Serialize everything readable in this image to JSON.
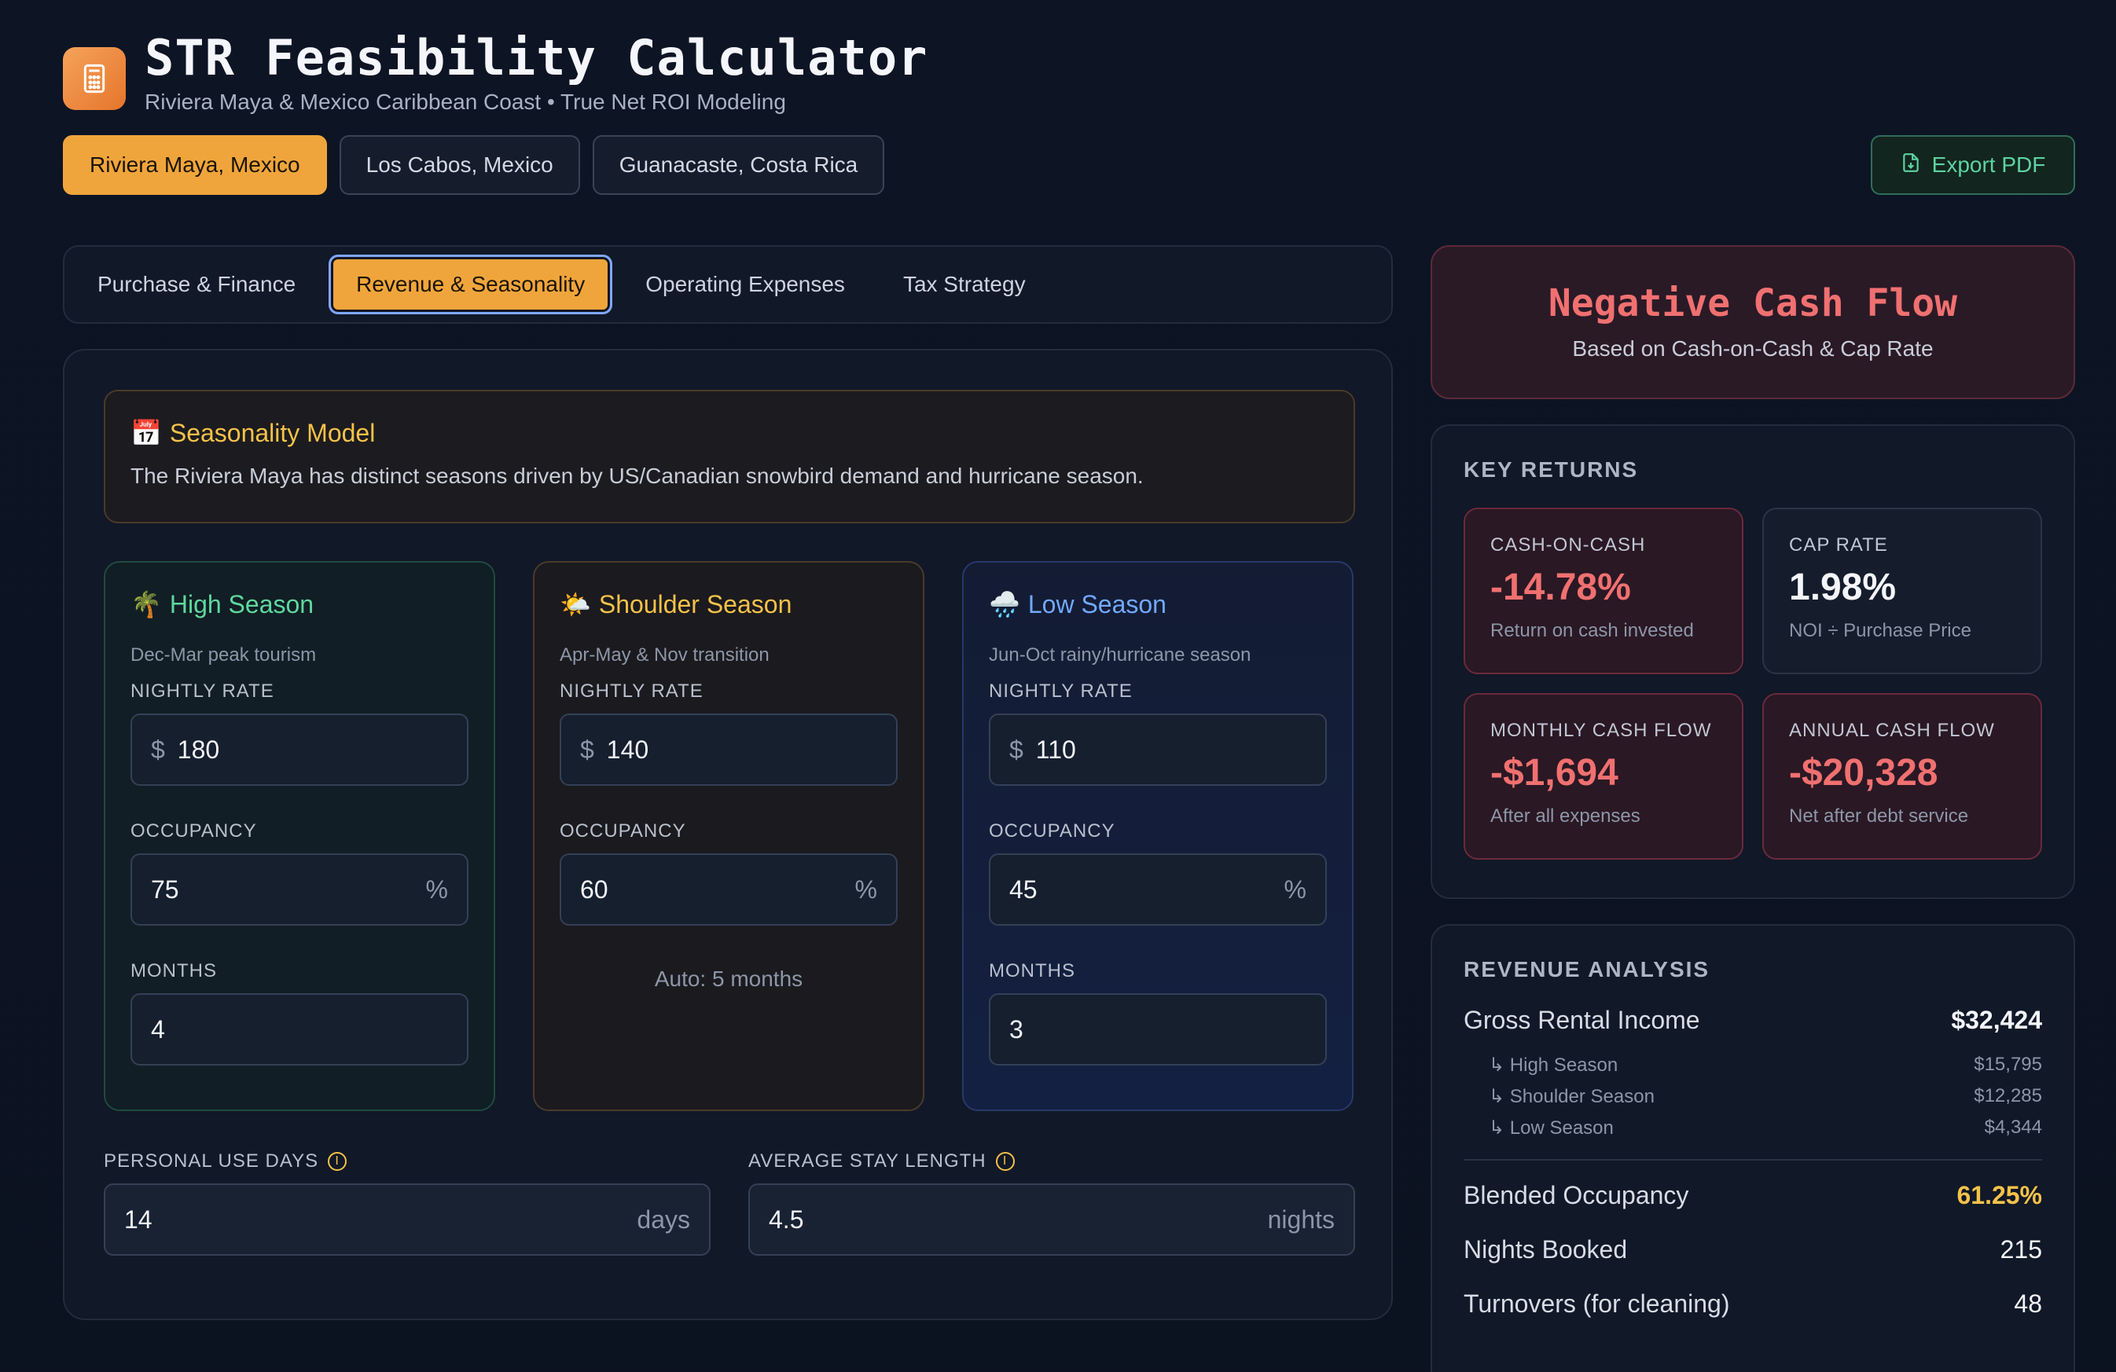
{
  "header": {
    "title": "STR Feasibility Calculator",
    "subtitle": "Riviera Maya & Mexico Caribbean Coast • True Net ROI Modeling"
  },
  "locations": [
    "Riviera Maya, Mexico",
    "Los Cabos, Mexico",
    "Guanacaste, Costa Rica"
  ],
  "export_label": "Export PDF",
  "tabs": [
    "Purchase & Finance",
    "Revenue & Seasonality",
    "Operating Expenses",
    "Tax Strategy"
  ],
  "seasonality": {
    "icon": "📅",
    "title": "Seasonality Model",
    "text": "The Riviera Maya has distinct seasons driven by US/Canadian snowbird demand and hurricane season."
  },
  "seasons": {
    "high": {
      "icon": "🌴",
      "title": "High Season",
      "desc": "Dec-Mar peak tourism",
      "nightly_label": "NIGHTLY RATE",
      "currency": "$",
      "rate": "180",
      "occ_label": "OCCUPANCY",
      "occupancy": "75",
      "pct": "%",
      "months_label": "MONTHS",
      "months": "4"
    },
    "shoulder": {
      "icon": "🌤️",
      "title": "Shoulder Season",
      "desc": "Apr-May & Nov transition",
      "nightly_label": "NIGHTLY RATE",
      "currency": "$",
      "rate": "140",
      "occ_label": "OCCUPANCY",
      "occupancy": "60",
      "pct": "%",
      "auto": "Auto: 5 months"
    },
    "low": {
      "icon": "🌧️",
      "title": "Low Season",
      "desc": "Jun-Oct rainy/hurricane season",
      "nightly_label": "NIGHTLY RATE",
      "currency": "$",
      "rate": "110",
      "occ_label": "OCCUPANCY",
      "occupancy": "45",
      "pct": "%",
      "months_label": "MONTHS",
      "months": "3"
    }
  },
  "personal_use": {
    "label": "PERSONAL USE DAYS",
    "value": "14",
    "unit": "days",
    "info": "i"
  },
  "avg_stay": {
    "label": "AVERAGE STAY LENGTH",
    "value": "4.5",
    "unit": "nights",
    "info": "i"
  },
  "status": {
    "title": "Negative Cash Flow",
    "subtitle": "Based on Cash-on-Cash & Cap Rate",
    "color": "#f07070"
  },
  "key_returns": {
    "title": "KEY RETURNS",
    "items": [
      {
        "label": "CASH-ON-CASH",
        "value": "-14.78%",
        "sub": "Return on cash invested"
      },
      {
        "label": "CAP RATE",
        "value": "1.98%",
        "sub": "NOI ÷ Purchase Price"
      },
      {
        "label": "MONTHLY CASH FLOW",
        "value": "-$1,694",
        "sub": "After all expenses"
      },
      {
        "label": "ANNUAL CASH FLOW",
        "value": "-$20,328",
        "sub": "Net after debt service"
      }
    ]
  },
  "revenue": {
    "title": "REVENUE ANALYSIS",
    "gross_label": "Gross Rental Income",
    "gross_value": "$32,424",
    "breakdown": [
      {
        "label": "↳ High Season",
        "value": "$15,795"
      },
      {
        "label": "↳ Shoulder Season",
        "value": "$12,285"
      },
      {
        "label": "↳ Low Season",
        "value": "$4,344"
      }
    ],
    "blended_label": "Blended Occupancy",
    "blended_value": "61.25%",
    "nights_label": "Nights Booked",
    "nights_value": "215",
    "turnovers_label": "Turnovers (for cleaning)",
    "turnovers_value": "48"
  },
  "colors": {
    "accent": "#f0a53c",
    "negative": "#f07070",
    "positive": "#5fd89e",
    "highlight": "#f5c249"
  }
}
